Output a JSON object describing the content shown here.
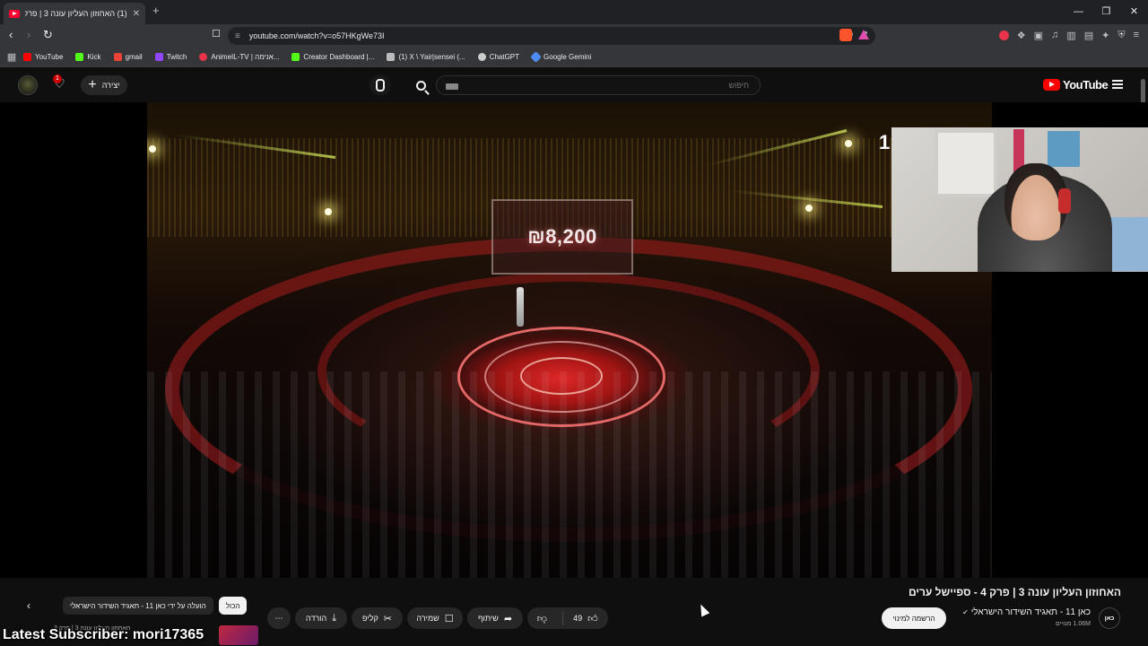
{
  "browser": {
    "tab_title": "(1) האחוזון העליון עונה 3 | פרק 4",
    "tab_close": "✕",
    "new_tab": "+",
    "window_buttons": [
      "—",
      "❐",
      "✕"
    ],
    "url": "youtube.com/watch?v=o57HKgWe73I",
    "bookmarks": [
      {
        "label": "YouTube",
        "color": "#ff0000"
      },
      {
        "label": "Kick",
        "color": "#53fc18"
      },
      {
        "label": "gmail",
        "color": "#ea4335"
      },
      {
        "label": "Twitch",
        "color": "#9146ff"
      },
      {
        "label": "AnimeIL-TV | אנימה...",
        "color": "#e8334a"
      },
      {
        "label": "Creator Dashboard |...",
        "color": "#53fc18"
      },
      {
        "label": "(1) X \\ Yair|sensei (...",
        "color": "#bbbbbb"
      },
      {
        "label": "ChatGPT",
        "color": "#cccccc"
      },
      {
        "label": "Google Gemini",
        "color": "#4e8cf5"
      }
    ]
  },
  "youtube_header": {
    "create_label": "יצירה",
    "notification_count": "1",
    "search_placeholder": "חיפוש",
    "logo_text": "YouTube"
  },
  "video": {
    "prize_display": "₪8,200",
    "time_peek": "1"
  },
  "below": {
    "title": "האחוזון העליון עונה 3 | פרק 4 - ספיישל ערים",
    "channel_avatar_text": "כאן",
    "channel_name": "כאן 11 - תאגיד השידור הישראלי",
    "verified_mark": "✔",
    "subscribers": "1.06M מנויים",
    "subscribe_label": "הרשמה למינוי",
    "like_count": "49",
    "share_label": "שיתוף",
    "save_label": "שמירה",
    "clip_label": "קליפ",
    "download_label": "הורדה",
    "more_label": "⋯",
    "chips": [
      {
        "label": "הכול",
        "active": true
      },
      {
        "label": "הועלה על ידי כאן 11 - תאגיד השידור הישראלי",
        "active": false
      }
    ],
    "rec_peek": "האחוזון העליון עונה 3 | פרק 3"
  },
  "overlay": {
    "latest_subscriber": "Latest Subscriber: mori17365"
  },
  "colors": {
    "accent": "#ff0000",
    "page_bg": "#0f0f0f",
    "pill_bg": "#272727"
  }
}
